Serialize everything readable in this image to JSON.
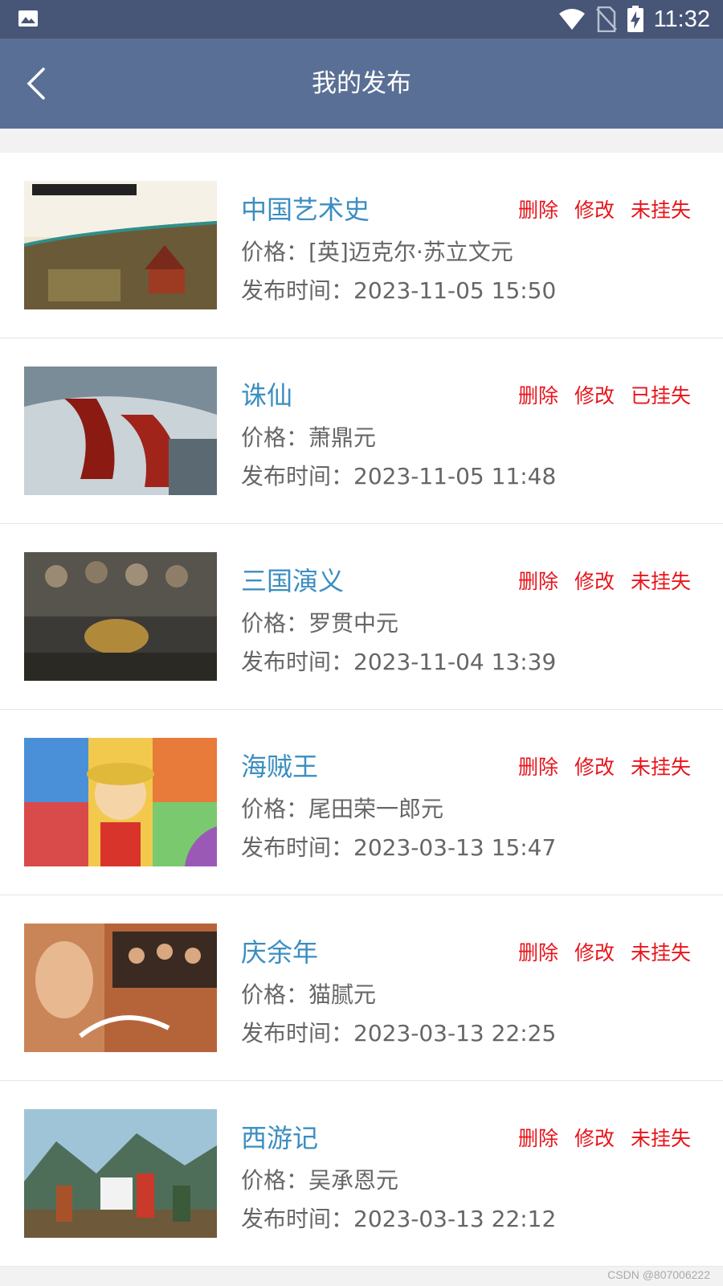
{
  "status_bar": {
    "time": "11:32",
    "icons": [
      "gallery-icon",
      "wifi-icon",
      "no-sim-icon",
      "battery-charging-icon"
    ]
  },
  "app_bar": {
    "title": "我的发布",
    "back_icon": "chevron-left-icon"
  },
  "labels": {
    "delete": "删除",
    "edit": "修改"
  },
  "items": [
    {
      "name": "中国艺术史",
      "price": "价格：[英]迈克尔·苏立文元",
      "time": "发布时间：2023-11-05 15:50",
      "status": "未挂失"
    },
    {
      "name": "诛仙",
      "price": "价格：萧鼎元",
      "time": "发布时间：2023-11-05 11:48",
      "status": "已挂失"
    },
    {
      "name": "三国演义",
      "price": "价格：罗贯中元",
      "time": "发布时间：2023-11-04 13:39",
      "status": "未挂失"
    },
    {
      "name": "海贼王",
      "price": "价格：尾田荣一郎元",
      "time": "发布时间：2023-03-13 15:47",
      "status": "未挂失"
    },
    {
      "name": "庆余年",
      "price": "价格：猫腻元",
      "time": "发布时间：2023-03-13 22:25",
      "status": "未挂失"
    },
    {
      "name": "西游记",
      "price": "价格：吴承恩元",
      "time": "发布时间：2023-03-13 22:12",
      "status": "未挂失"
    }
  ],
  "watermark": "CSDN @807006222",
  "colors": {
    "status_bar": "#475577",
    "app_bar": "#5a6f95",
    "title_text": "#3b8ec0",
    "action_text": "#e8141b",
    "body_text": "#666666"
  }
}
